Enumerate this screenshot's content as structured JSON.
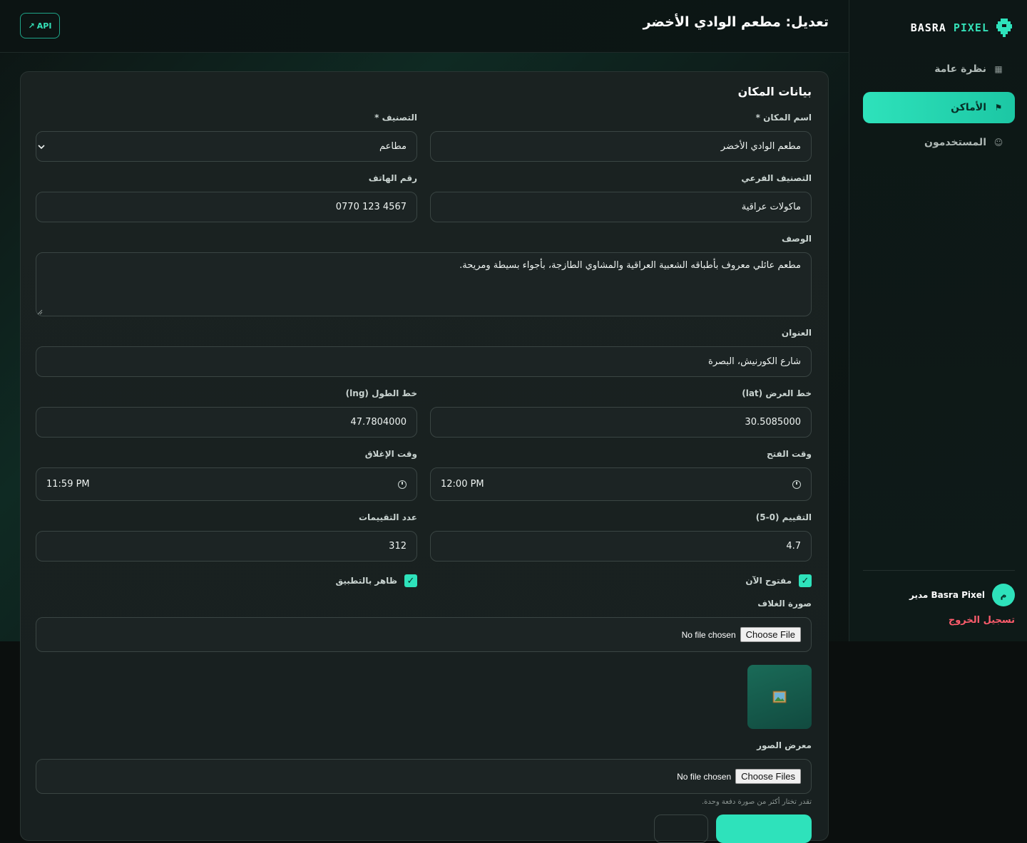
{
  "brand": {
    "name_part1": "BASRA",
    "name_part2": "PIXEL"
  },
  "sidebar": {
    "items": [
      {
        "label": "نظرة عامة",
        "icon": "▦"
      },
      {
        "label": "الأماكن",
        "icon": "⚑"
      },
      {
        "label": "المستخدمون",
        "icon": "☺"
      }
    ],
    "user": {
      "avatar_letter": "م",
      "name": "Basra Pixel مدير"
    },
    "logout_label": "تسجيل الخروج"
  },
  "header": {
    "title": "تعديل: مطعم الوادي الأخضر",
    "api_label": "API",
    "api_icon": "↗"
  },
  "form": {
    "section_title": "بيانات المكان",
    "name_label": "اسم المكان *",
    "name_value": "مطعم الوادي الأخضر",
    "category_label": "التصنيف *",
    "category_value": "مطاعم",
    "subcategory_label": "التصنيف الفرعي",
    "subcategory_value": "ماكولات عراقية",
    "phone_label": "رقم الهاتف",
    "phone_value": "0770 123 4567",
    "description_label": "الوصف",
    "description_value": "مطعم عائلي معروف بأطباقه الشعبية العراقية والمشاوي الطازجة، بأجواء بسيطة ومريحة.",
    "address_label": "العنوان",
    "address_value": "شارع الكورنيش، البصرة",
    "lat_label": "خط العرض (lat)",
    "lat_value": "30.5085000",
    "lng_label": "خط الطول (lng)",
    "lng_value": "47.7804000",
    "open_label": "وقت الفتح",
    "open_value": "12:00 PM",
    "close_label": "وقت الإغلاق",
    "close_value": "11:59 PM",
    "rating_label": "التقييم (0-5)",
    "rating_value": "4.7",
    "reviews_label": "عدد التقييمات",
    "reviews_value": "312",
    "open_now_label": "مفتوح الآن",
    "open_now_checked": true,
    "visible_label": "ظاهر بالتطبيق",
    "visible_checked": true,
    "cover_label": "صورة الغلاف",
    "cover_button": "Choose File",
    "cover_note": "No file chosen",
    "gallery_label": "معرض الصور",
    "gallery_button": "Choose Files",
    "gallery_note": "No file chosen",
    "gallery_hint": "تقدر تختار أكثر من صورة دفعة وحدة."
  },
  "colors": {
    "accent": "#2ee2bb",
    "danger": "#ff5c6c",
    "background": "#0b0f0e"
  }
}
